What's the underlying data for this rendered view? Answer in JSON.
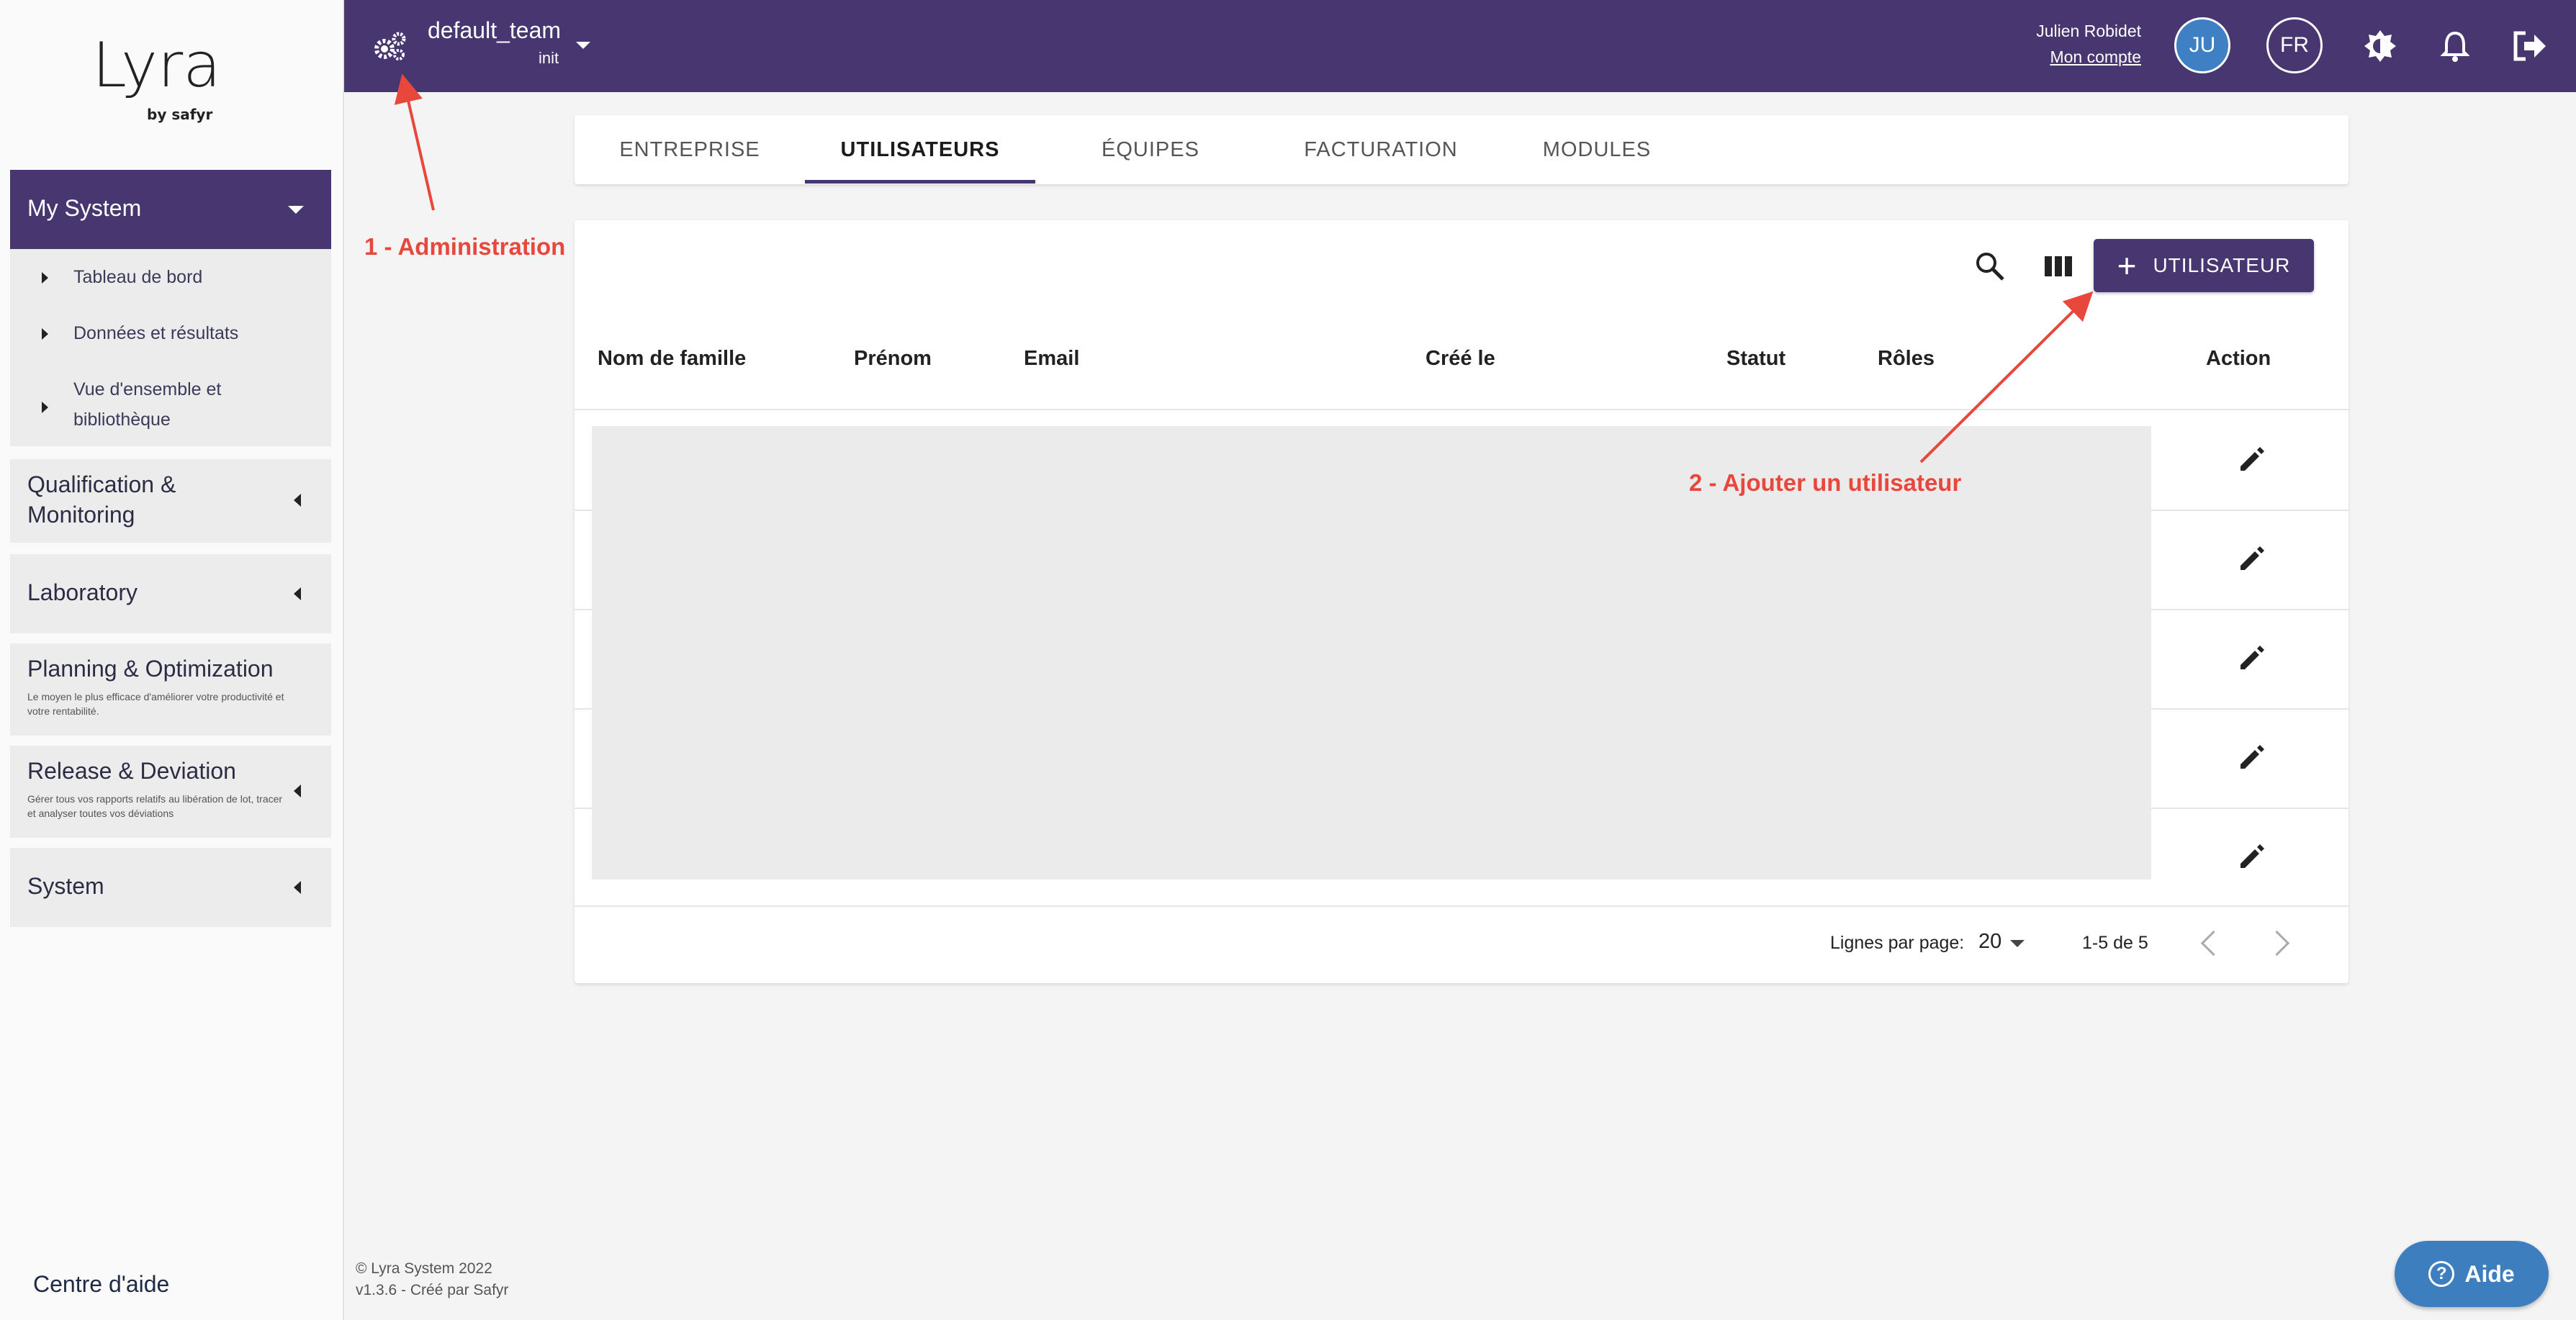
{
  "brand": {
    "logo_text": "Lyra",
    "logo_sub": "by safyr"
  },
  "sidebar": {
    "sections": [
      {
        "title": "My System",
        "expanded": true,
        "items": [
          {
            "label": "Tableau de bord"
          },
          {
            "label": "Données et résultats"
          },
          {
            "label": "Vue d'ensemble et bibliothèque"
          }
        ]
      },
      {
        "title": "Qualification & Monitoring",
        "description": ""
      },
      {
        "title": "Laboratory",
        "description": ""
      },
      {
        "title": "Planning & Optimization",
        "description": "Le moyen le plus efficace d'améliorer votre productivité et votre rentabilité."
      },
      {
        "title": "Release & Deviation",
        "description": "Gérer tous vos rapports relatifs au libération de lot, tracer et analyser toutes vos déviations"
      },
      {
        "title": "System",
        "description": ""
      }
    ],
    "help_link": "Centre d'aide"
  },
  "topbar": {
    "team_name": "default_team",
    "team_sub": "init",
    "user_name": "Julien Robidet",
    "account_link": "Mon compte",
    "avatar_initials": "JU",
    "language": "FR",
    "icons": [
      "settings-gears-icon",
      "theme-toggle-icon",
      "notifications-bell-icon",
      "logout-icon"
    ]
  },
  "tabs": [
    {
      "label": "ENTREPRISE",
      "active": false
    },
    {
      "label": "UTILISATEURS",
      "active": true
    },
    {
      "label": "ÉQUIPES",
      "active": false
    },
    {
      "label": "FACTURATION",
      "active": false
    },
    {
      "label": "MODULES",
      "active": false
    }
  ],
  "table": {
    "add_button": "UTILISATEUR",
    "columns": [
      "Nom de famille",
      "Prénom",
      "Email",
      "Créé le",
      "Statut",
      "Rôles",
      "Action"
    ],
    "row_count_visible": 5,
    "rows_per_page_label": "Lignes par page:",
    "rows_per_page": "20",
    "range": "1-5 de 5"
  },
  "annotations": {
    "admin": "1 - Administration",
    "add_user": "2 - Ajouter un utilisateur",
    "color": "#e8473b"
  },
  "footer": {
    "copyright": "© Lyra System 2022",
    "version": "v1.3.6 - Créé par Safyr"
  },
  "help_button": "Aide",
  "colors": {
    "brand_purple": "#47366f",
    "help_blue": "#3d7ebf",
    "avatar_blue": "#3f7fc4"
  }
}
